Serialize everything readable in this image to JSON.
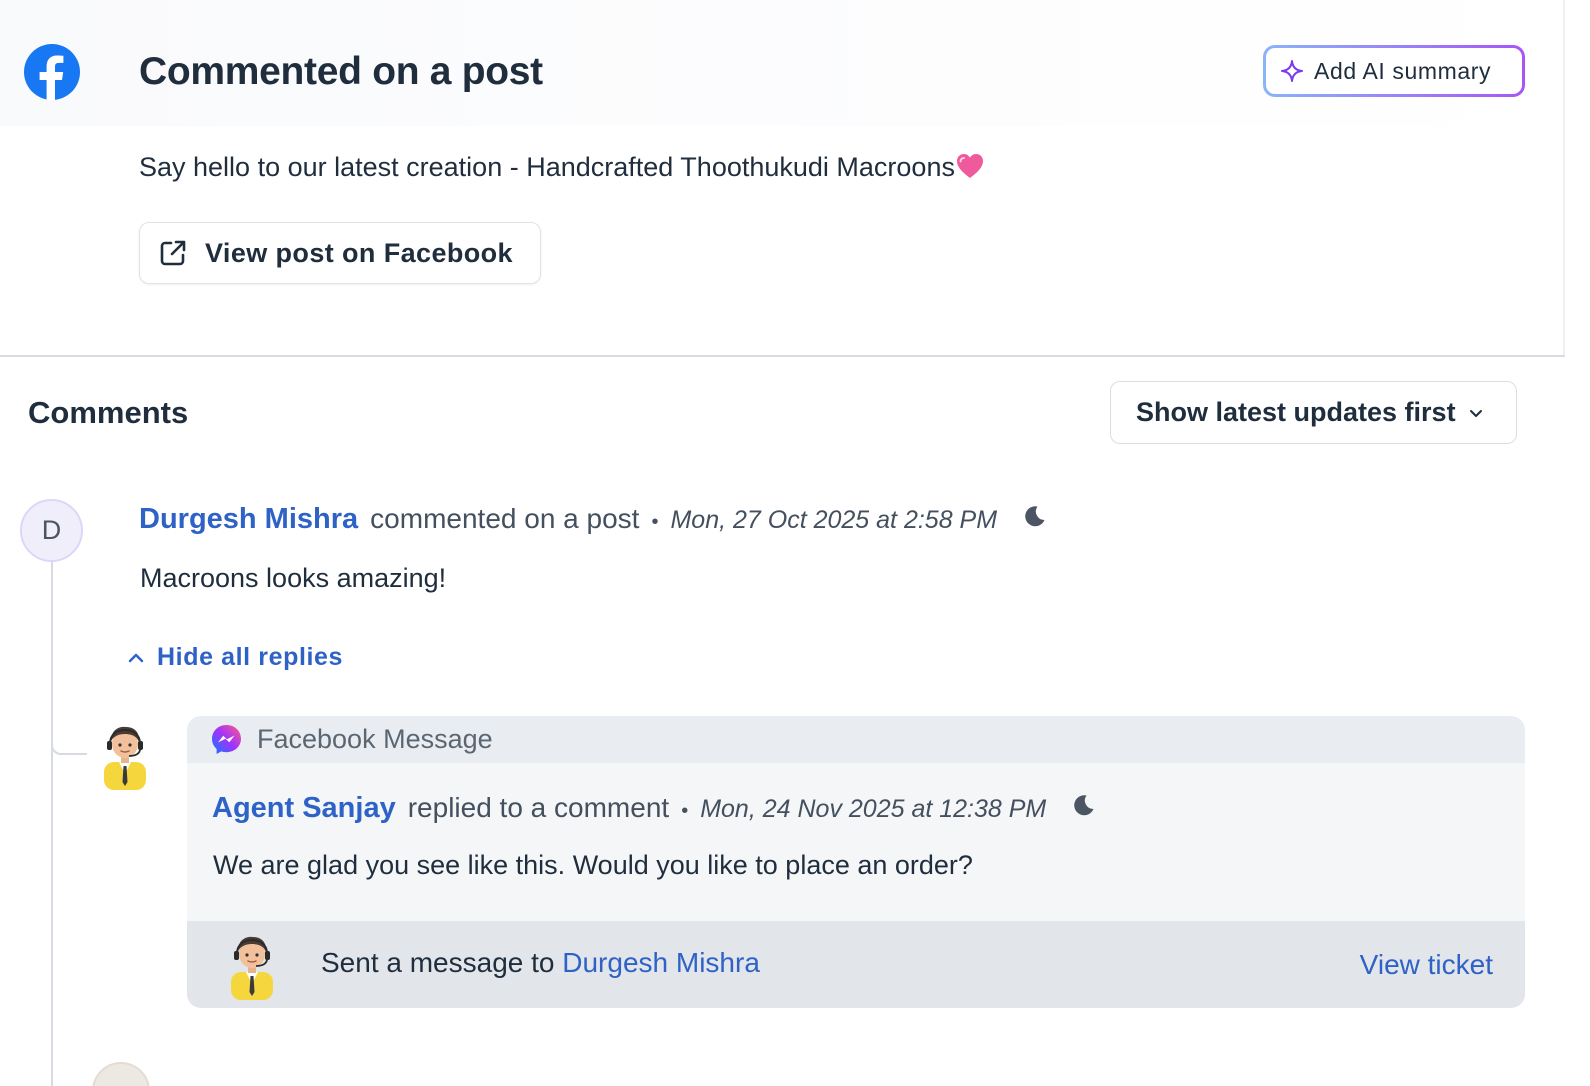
{
  "header": {
    "title": "Commented on a post",
    "ai_button_label": "Add AI summary"
  },
  "post": {
    "text": "Say hello to our latest creation - Handcrafted Thoothukudi Macroons",
    "view_button_label": "View post on Facebook"
  },
  "comments": {
    "heading": "Comments",
    "sort_label": "Show latest updates first",
    "items": [
      {
        "avatar_initial": "D",
        "author": "Durgesh Mishra",
        "action": "commented on a post",
        "separator": "•",
        "timestamp": "Mon, 27 Oct 2025 at 2:58 PM",
        "body": "Macroons looks amazing!",
        "hide_replies_label": "Hide all replies",
        "replies": [
          {
            "channel": "Facebook Message",
            "author": "Agent Sanjay",
            "action": "replied to a comment",
            "separator": "•",
            "timestamp": "Mon, 24 Nov 2025 at 12:38 PM",
            "body": "We are glad you see like this. Would you like to place an order?",
            "sent_prefix": "Sent a message to ",
            "sent_to": "Durgesh Mishra",
            "view_ticket_label": "View ticket"
          }
        ]
      }
    ]
  },
  "icons": {
    "brand": "facebook-icon",
    "ai": "sparkle-icon",
    "external": "external-link-icon",
    "sort": "chevron-down-icon",
    "collapse": "chevron-up-icon",
    "channel": "messenger-icon",
    "sleep": "moon-icon",
    "heart": "heart-emoji-icon"
  },
  "colors": {
    "link": "#2f62c6",
    "facebook": "#1877f2",
    "ai_gradient_start": "#8ab4f8",
    "ai_gradient_end": "#a855f7"
  }
}
